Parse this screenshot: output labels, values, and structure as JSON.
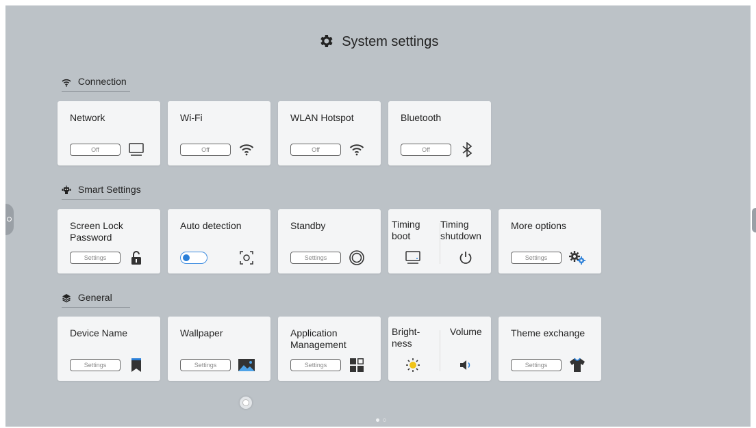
{
  "header": {
    "title": "System settings",
    "icon": "gear-icon"
  },
  "sections": {
    "connection": {
      "label": "Connection",
      "icon": "wifi-icon"
    },
    "smart": {
      "label": "Smart Settings",
      "icon": "robot-icon"
    },
    "general": {
      "label": "General",
      "icon": "layers-icon"
    }
  },
  "connection": {
    "network": {
      "label": "Network",
      "state": "Off"
    },
    "wifi": {
      "label": "Wi-Fi",
      "state": "Off"
    },
    "hotspot": {
      "label": "WLAN Hotspot",
      "state": "Off"
    },
    "bluetooth": {
      "label": "Bluetooth",
      "state": "Off"
    }
  },
  "smart": {
    "screen_lock": {
      "label_line1": "Screen Lock",
      "label_line2": "Password",
      "button": "Settings"
    },
    "auto_detection": {
      "label": "Auto detection",
      "toggle_on": true
    },
    "standby": {
      "label": "Standby",
      "button": "Settings"
    },
    "timing": {
      "boot_line1": "Timing",
      "boot_line2": "boot",
      "shutdown_line1": "Timing",
      "shutdown_line2": "shutdown"
    },
    "more_options": {
      "label": "More options",
      "button": "Settings"
    }
  },
  "general": {
    "device_name": {
      "label": "Device Name",
      "button": "Settings"
    },
    "wallpaper": {
      "label": "Wallpaper",
      "button": "Settings"
    },
    "app_management": {
      "label_line1": "Application",
      "label_line2": "Management",
      "button": "Settings"
    },
    "brightness_volume": {
      "brightness_line1": "Bright-",
      "brightness_line2": "ness",
      "volume": "Volume"
    },
    "theme_exchange": {
      "label": "Theme exchange",
      "button": "Settings"
    }
  },
  "pager": {
    "current": 1,
    "total": 2
  },
  "colors": {
    "background": "#bcc2c7",
    "card": "#f4f5f6",
    "accent_blue": "#2a7fd8",
    "sun_yellow": "#f0c419",
    "icon_dark": "#333333"
  }
}
